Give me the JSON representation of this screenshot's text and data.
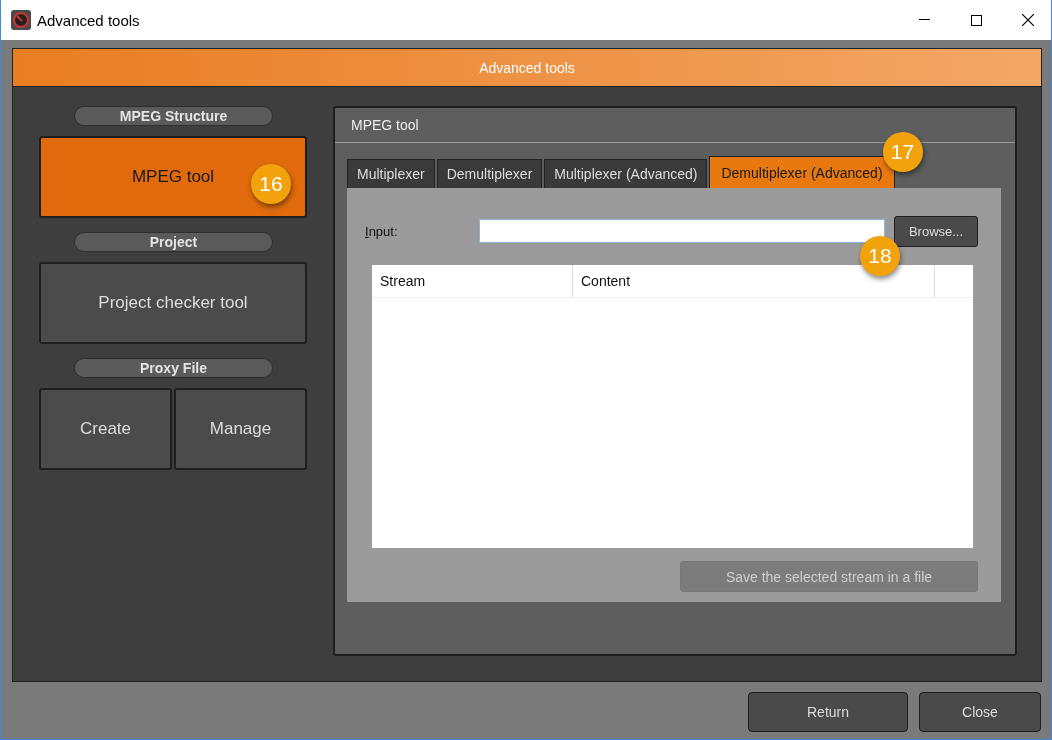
{
  "window": {
    "title": "Advanced tools"
  },
  "header": {
    "title": "Advanced tools"
  },
  "sidebar": {
    "sections": [
      {
        "label": "MPEG Structure",
        "buttons": [
          {
            "label": "MPEG tool",
            "selected": true,
            "callout": "16"
          }
        ]
      },
      {
        "label": "Project",
        "buttons": [
          {
            "label": "Project checker tool",
            "selected": false
          }
        ]
      },
      {
        "label": "Proxy File",
        "buttons": [
          {
            "label": "Create",
            "selected": false
          },
          {
            "label": "Manage",
            "selected": false
          }
        ]
      }
    ]
  },
  "panel": {
    "title": "MPEG tool",
    "tabs": [
      {
        "label": "Multiplexer",
        "selected": false
      },
      {
        "label": "Demultiplexer",
        "selected": false
      },
      {
        "label": "Multiplexer (Advanced)",
        "selected": false
      },
      {
        "label": "Demultiplexer (Advanced)",
        "selected": true,
        "callout": "17"
      }
    ],
    "input": {
      "label": "Input:"
    },
    "browse_button": {
      "label": "Browse...",
      "callout": "18"
    },
    "table": {
      "columns": [
        "Stream",
        "Content"
      ]
    },
    "save_button": {
      "label": "Save the selected stream in a file",
      "disabled": true
    }
  },
  "footer": {
    "buttons": [
      "Return",
      "Close"
    ]
  }
}
